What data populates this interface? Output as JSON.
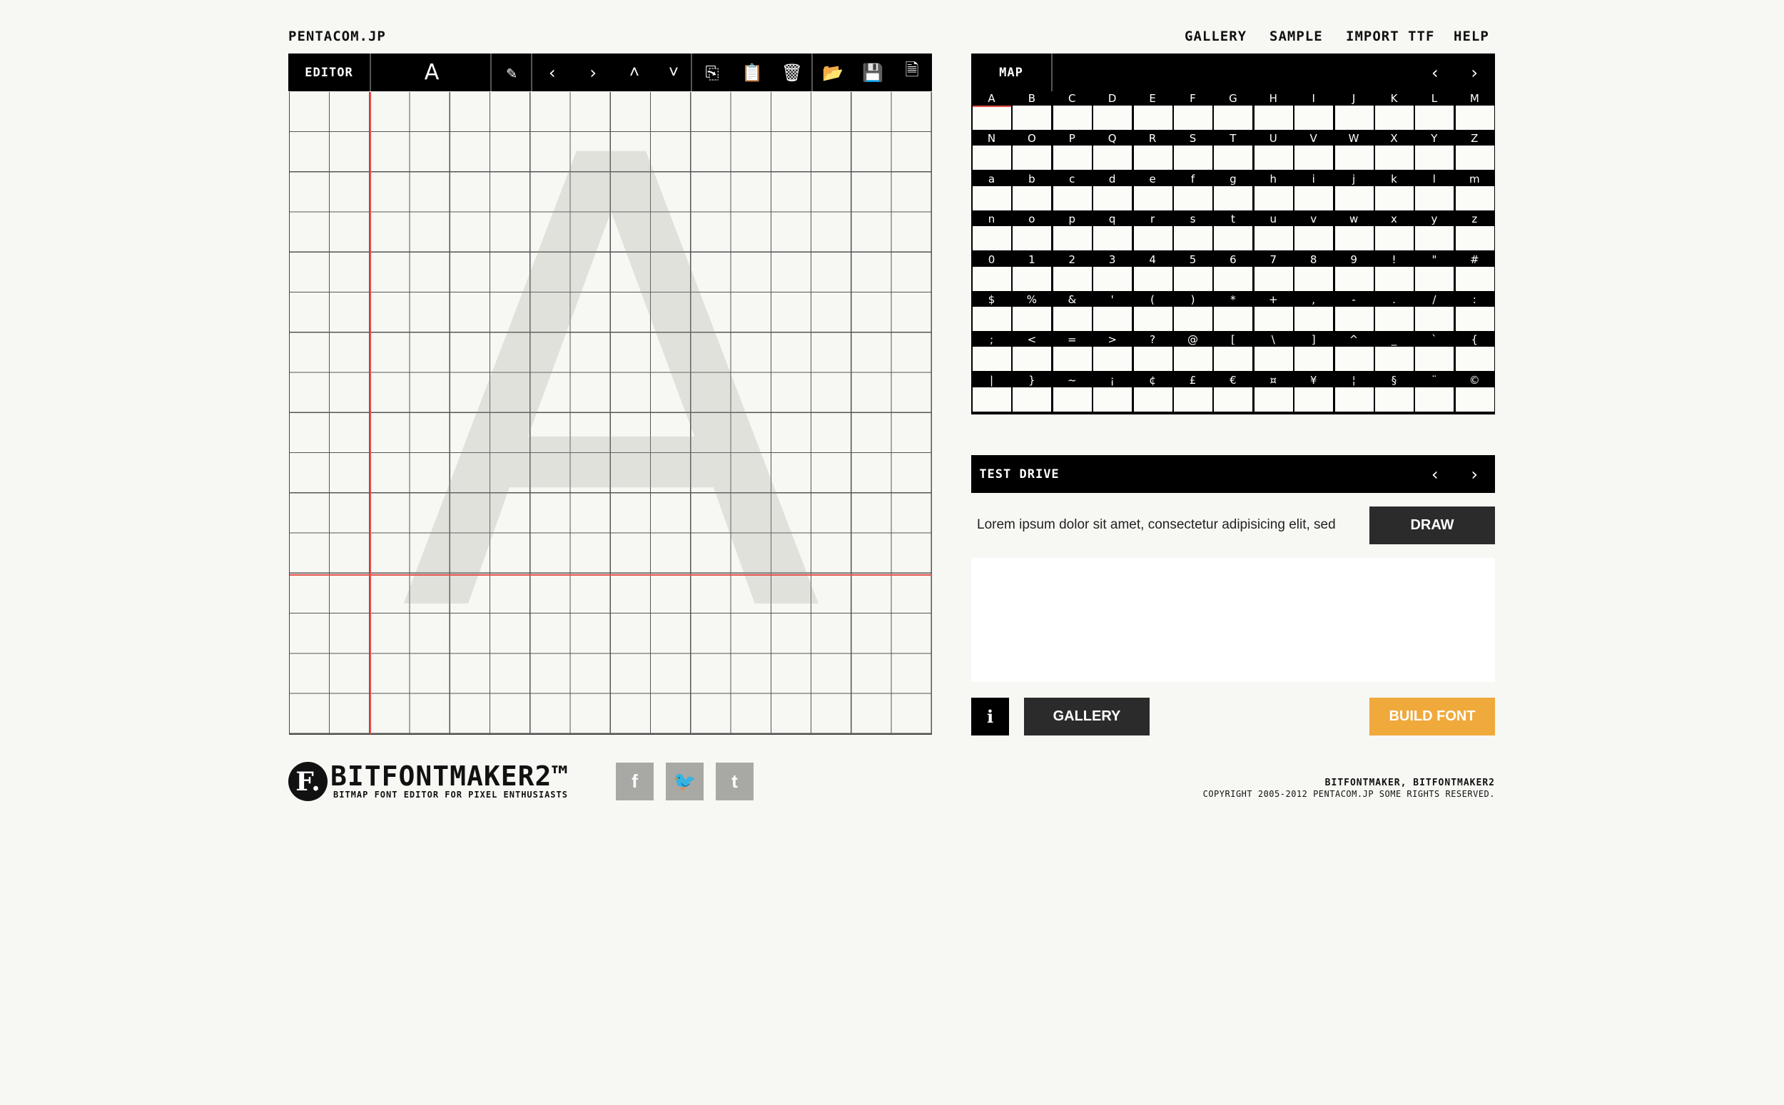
{
  "header": {
    "site_name": "PENTACOM.JP",
    "nav": [
      "GALLERY",
      "SAMPLE",
      "IMPORT TTF",
      "HELP"
    ]
  },
  "editor": {
    "label": "EDITOR",
    "current_glyph": "A",
    "tools": [
      {
        "icon": "magic-wand-icon",
        "glyph": "✎"
      },
      {
        "icon": "shift-left-icon",
        "glyph": "‹"
      },
      {
        "icon": "shift-right-icon",
        "glyph": "›"
      },
      {
        "icon": "shift-up-icon",
        "glyph": "˄"
      },
      {
        "icon": "shift-down-icon",
        "glyph": "˅"
      },
      {
        "icon": "copy-icon",
        "glyph": "⎘"
      },
      {
        "icon": "paste-icon",
        "glyph": "📋"
      },
      {
        "icon": "trash-icon",
        "glyph": "🗑"
      },
      {
        "icon": "open-folder-icon",
        "glyph": "📂"
      },
      {
        "icon": "save-icon",
        "glyph": "💾"
      },
      {
        "icon": "export-icon",
        "glyph": "🗎"
      }
    ],
    "guide_glyph": "A",
    "guide_color": "#e2514a"
  },
  "map": {
    "label": "MAP",
    "prev_glyph": "‹",
    "next_glyph": "›",
    "rows": [
      [
        "A",
        "B",
        "C",
        "D",
        "E",
        "F",
        "G",
        "H",
        "I",
        "J",
        "K",
        "L",
        "M"
      ],
      [
        "N",
        "O",
        "P",
        "Q",
        "R",
        "S",
        "T",
        "U",
        "V",
        "W",
        "X",
        "Y",
        "Z"
      ],
      [
        "a",
        "b",
        "c",
        "d",
        "e",
        "f",
        "g",
        "h",
        "i",
        "j",
        "k",
        "l",
        "m"
      ],
      [
        "n",
        "o",
        "p",
        "q",
        "r",
        "s",
        "t",
        "u",
        "v",
        "w",
        "x",
        "y",
        "z"
      ],
      [
        "0",
        "1",
        "2",
        "3",
        "4",
        "5",
        "6",
        "7",
        "8",
        "9",
        "!",
        "\"",
        "#"
      ],
      [
        "$",
        "%",
        "&",
        "'",
        "(",
        ")",
        "*",
        "+",
        ",",
        "-",
        ".",
        "/",
        ":"
      ],
      [
        ";",
        "<",
        "=",
        ">",
        "?",
        "@",
        "[",
        "\\",
        "]",
        "^",
        "_",
        "`",
        "{"
      ],
      [
        "|",
        "}",
        "~",
        "¡",
        "¢",
        "£",
        "€",
        "¤",
        "¥",
        "¦",
        "§",
        "¨",
        "©"
      ]
    ],
    "active": "A"
  },
  "test_drive": {
    "label": "TEST DRIVE",
    "prev_glyph": "‹",
    "next_glyph": "›",
    "input_value": "Lorem ipsum dolor sit amet, consectetur adipisicing elit, sed",
    "draw_label": "DRAW"
  },
  "actions": {
    "info_label": "i",
    "gallery_label": "GALLERY",
    "build_label": "BUILD FONT",
    "build_color": "#f0a93b"
  },
  "footer": {
    "logo_mark": "F.",
    "logo_name": "BITFONTMAKER2™",
    "tagline": "BITMAP FONT EDITOR FOR PIXEL ENTHUSIASTS",
    "social": [
      {
        "icon": "facebook-icon",
        "glyph": "f"
      },
      {
        "icon": "twitter-icon",
        "glyph": "🐦"
      },
      {
        "icon": "tumblr-icon",
        "glyph": "t"
      }
    ],
    "title": "BITFONTMAKER, BITFONTMAKER2",
    "copyright": "COPYRIGHT 2005-2012 PENTACOM.JP SOME RIGHTS RESERVED."
  }
}
